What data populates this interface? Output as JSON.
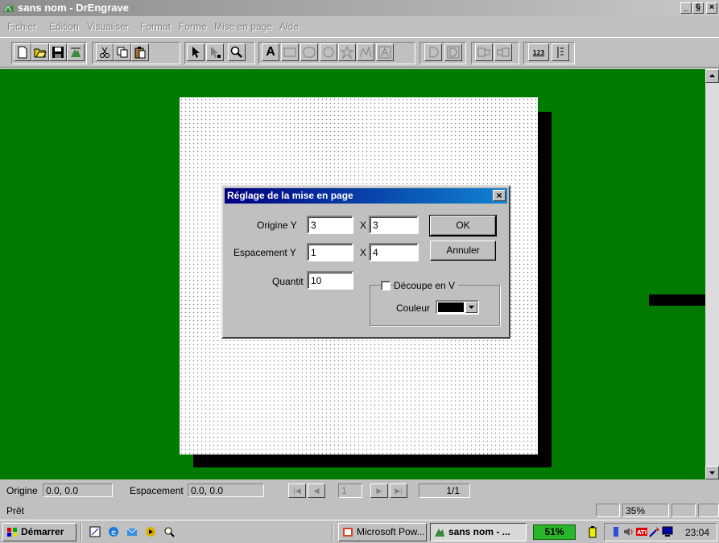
{
  "window": {
    "title": "sans nom - DrEngrave",
    "min": "_",
    "max": "§",
    "close": "×"
  },
  "menu": [
    "Fichier",
    "Edition",
    "Visualiser",
    "Format",
    "Forme",
    "Mise en page",
    "Aide"
  ],
  "toolbar": {
    "text_tool_label": "A",
    "counter_label": "123",
    "icons": [
      "new-icon",
      "open-icon",
      "save-icon",
      "import-icon",
      "cut-icon",
      "copy-icon",
      "paste-icon",
      "select-arrow-icon",
      "node-edit-icon",
      "zoom-icon",
      "text-icon",
      "rectangle-icon",
      "rounded-rect-icon",
      "ellipse-icon",
      "star-icon",
      "polyline-icon",
      "frame-text-icon",
      "d-icon",
      "double-d-icon",
      "layout-left-icon",
      "layout-right-icon",
      "counter-icon",
      "ruler-icon"
    ]
  },
  "dialog": {
    "title": "Réglage de la mise en page",
    "close": "×",
    "origine_label": "Origine  Y",
    "origine_y": "3",
    "origine_x_label": "X",
    "origine_x": "3",
    "espacement_label": "Espacement  Y",
    "espacement_y": "1",
    "espacement_x_label": "X",
    "espacement_x": "4",
    "quantite_label": "Quantit",
    "quantite": "10",
    "ok": "OK",
    "annuler": "Annuler",
    "decoupe_label": "Découpe en V",
    "decoupe_checked": false,
    "couleur_label": "Couleur",
    "couleur_value": "#000000"
  },
  "status": {
    "origine_label": "Origine",
    "origine_value": "0.0, 0.0",
    "espacement_label": "Espacement",
    "espacement_value": "0.0, 0.0",
    "page_input": "1",
    "page_count": "1/1",
    "ready": "Prêt",
    "zoom": "35%"
  },
  "taskbar": {
    "start": "Démarrer",
    "tasks": [
      "Microsoft Pow...",
      "sans nom - ..."
    ],
    "battery": "51%",
    "clock": "23:04"
  },
  "colors": {
    "workspace": "#007a00",
    "dialog_title": "#000080",
    "page": "#ffffff"
  }
}
